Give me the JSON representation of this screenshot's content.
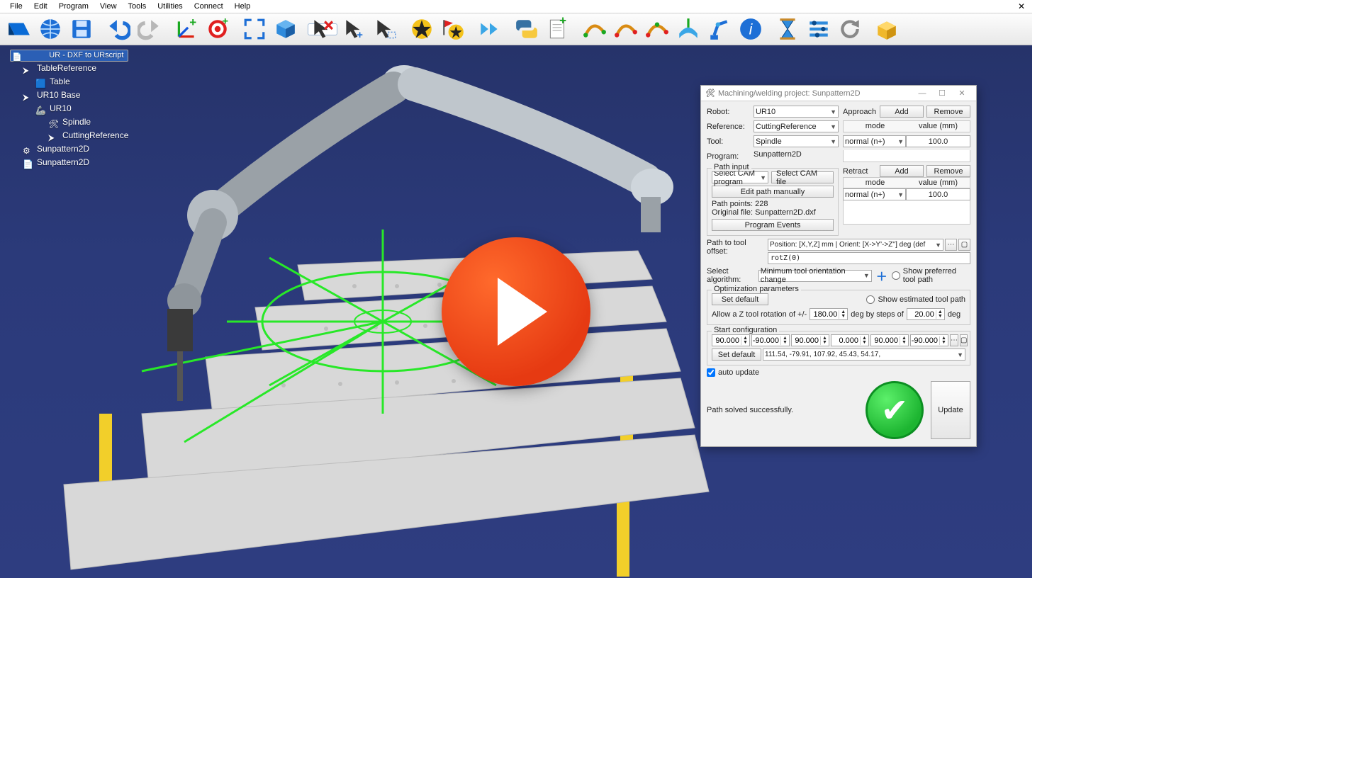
{
  "menu": [
    "File",
    "Edit",
    "Program",
    "View",
    "Tools",
    "Utilities",
    "Connect",
    "Help"
  ],
  "tree": {
    "root": "UR - DXF to URscript",
    "items": [
      {
        "depth": 1,
        "label": "TableReference",
        "icon": "frame"
      },
      {
        "depth": 2,
        "label": "Table",
        "icon": "cube"
      },
      {
        "depth": 1,
        "label": "UR10 Base",
        "icon": "frame"
      },
      {
        "depth": 2,
        "label": "UR10",
        "icon": "robot"
      },
      {
        "depth": 3,
        "label": "Spindle",
        "icon": "tool"
      },
      {
        "depth": 3,
        "label": "CuttingReference",
        "icon": "frame2"
      },
      {
        "depth": 1,
        "label": "Sunpattern2D",
        "icon": "mill"
      },
      {
        "depth": 1,
        "label": "Sunpattern2D",
        "icon": "file"
      }
    ]
  },
  "panel": {
    "title": "Machining/welding project: Sunpattern2D",
    "robot_lbl": "Robot:",
    "robot_val": "UR10",
    "reference_lbl": "Reference:",
    "reference_val": "CuttingReference",
    "tool_lbl": "Tool:",
    "tool_val": "Spindle",
    "program_lbl": "Program:",
    "program_val": "Sunpattern2D",
    "approach_lbl": "Approach",
    "retract_lbl": "Retract",
    "add_btn": "Add",
    "remove_btn": "Remove",
    "mode_hdr": "mode",
    "value_hdr": "value (mm)",
    "approach_mode": "normal (n+)",
    "approach_val": "100.0",
    "retract_mode": "normal (n+)",
    "retract_val": "100.0",
    "path_input_lbl": "Path input",
    "sel_cam_prog": "Select CAM program",
    "sel_cam_file": "Select CAM file",
    "edit_path": "Edit path manually",
    "path_points_lbl": "Path points:",
    "path_points_val": "228",
    "orig_file_lbl": "Original file:",
    "orig_file_val": "Sunpattern2D.dxf",
    "prog_events": "Program Events",
    "path_tool_offset_lbl": "Path to tool offset:",
    "pos_orient": "Position: [X,Y,Z] mm | Orient: [X->Y'->Z''] deg (def",
    "rotz": "rotZ(0)",
    "sel_algo_lbl": "Select algorithm:",
    "sel_algo_val": "Minimum tool orientation change",
    "show_pref": "Show preferred tool path",
    "opt_params_lbl": "Optimization parameters",
    "set_default": "Set default",
    "show_est": "Show estimated tool path",
    "allow_z_a": "Allow a Z tool rotation of +/-",
    "allow_z_val": "180.00",
    "allow_z_b": "deg by steps of",
    "allow_z_step": "20.00",
    "allow_z_c": "deg",
    "start_cfg_lbl": "Start configuration",
    "j": [
      "90.000",
      "-90.000",
      "90.000",
      "0.000",
      "90.000",
      "-90.000"
    ],
    "solved_row": "111.54,    -79.91,    107.92,     45.43,     54.17,",
    "auto_update": "auto update",
    "solved_msg": "Path solved successfully.",
    "update_btn": "Update"
  }
}
